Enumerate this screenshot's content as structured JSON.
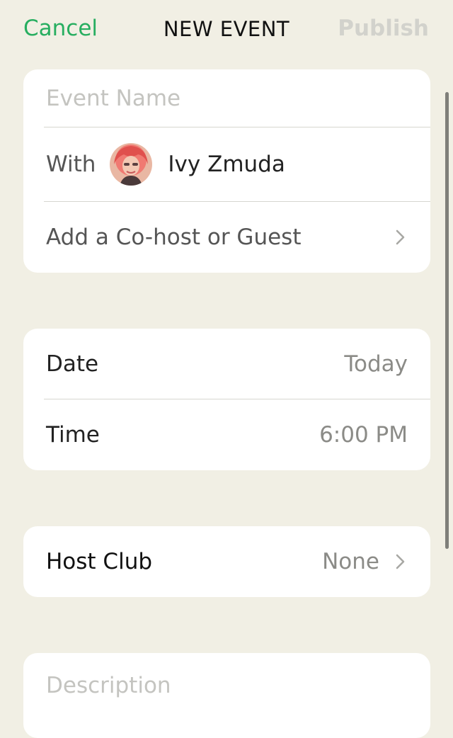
{
  "header": {
    "cancel_label": "Cancel",
    "title": "NEW EVENT",
    "publish_label": "Publish"
  },
  "event": {
    "name_placeholder": "Event Name",
    "with_label": "With",
    "host_name": "Ivy Zmuda",
    "add_guest_label": "Add a Co-host or Guest"
  },
  "schedule": {
    "date_label": "Date",
    "date_value": "Today",
    "time_label": "Time",
    "time_value": "6:00 PM"
  },
  "club": {
    "host_club_label": "Host Club",
    "host_club_value": "None"
  },
  "description": {
    "placeholder": "Description"
  },
  "colors": {
    "accent": "#27ae60",
    "background": "#f1efe4",
    "publish_disabled": "#d2d2cc"
  }
}
